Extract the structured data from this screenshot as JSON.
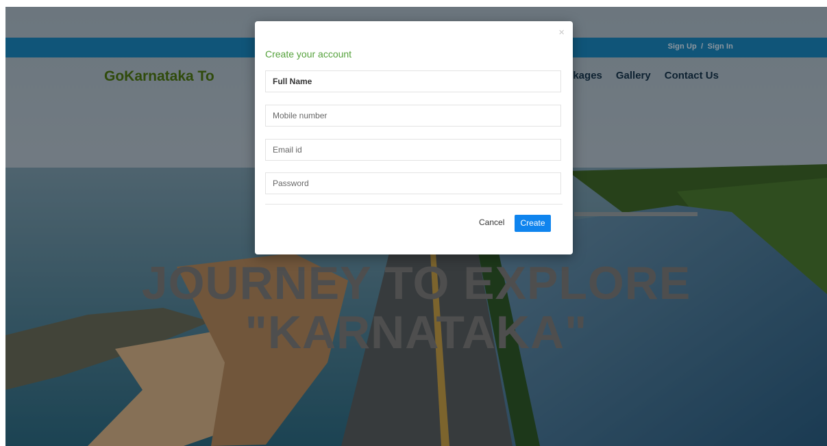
{
  "header": {
    "brand": "GoKarnataka To",
    "auth": {
      "sign_up": "Sign Up",
      "separator": "/",
      "sign_in": "Sign In"
    },
    "nav": [
      "ckages",
      "Gallery",
      "Contact Us"
    ]
  },
  "hero": {
    "line1": "JOURNEY TO EXPLORE",
    "line2": "\"KARNATAKA\""
  },
  "modal": {
    "title": "Create your account",
    "close": "×",
    "fields": [
      {
        "name": "full-name",
        "placeholder": "Full Name"
      },
      {
        "name": "mobile-number",
        "placeholder": "Mobile number"
      },
      {
        "name": "email-id",
        "placeholder": "Email id"
      },
      {
        "name": "password",
        "placeholder": "Password"
      }
    ],
    "cancel_label": "Cancel",
    "create_label": "Create"
  },
  "colors": {
    "topbar": "#1a8ac4",
    "brand": "#4e7a14",
    "modal_title": "#54a13b",
    "primary_button": "#0f84ee"
  }
}
